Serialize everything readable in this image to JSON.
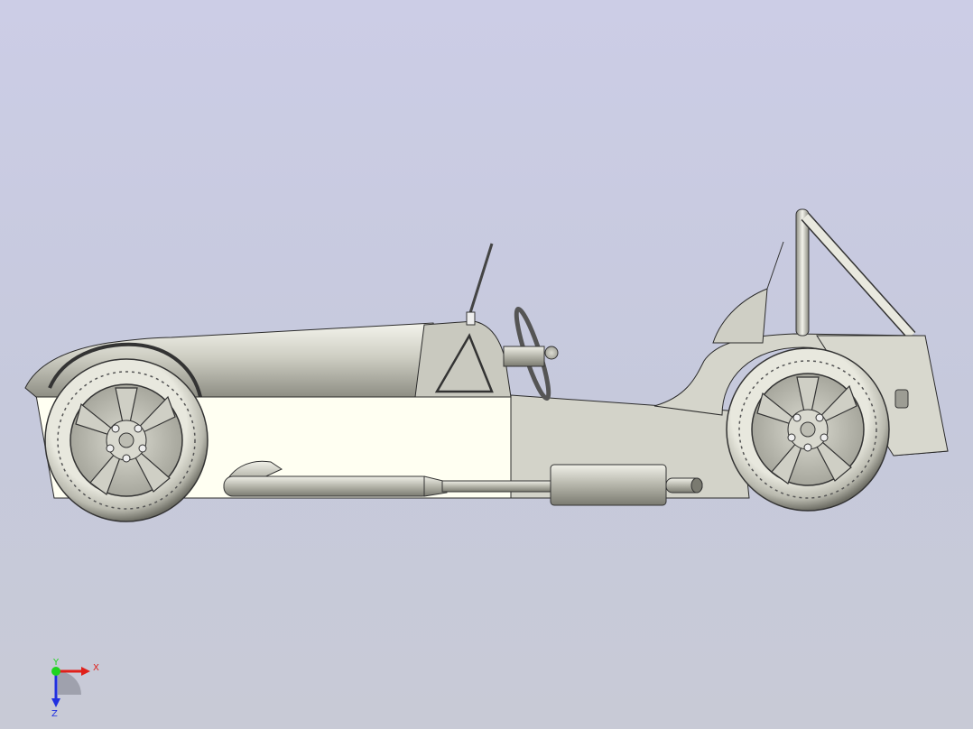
{
  "viewport": {
    "background_top": "#cccde6",
    "background_bottom": "#c8cad6"
  },
  "model": {
    "body_color": "#d9d9cf",
    "panel_color": "#fffff2",
    "edge_color": "#2b2b2b"
  },
  "triad": {
    "x_label": "X",
    "y_label": "Y",
    "z_label": "Z",
    "x_color": "#e0201a",
    "y_color": "#1fd41f",
    "z_color": "#2030e0"
  }
}
